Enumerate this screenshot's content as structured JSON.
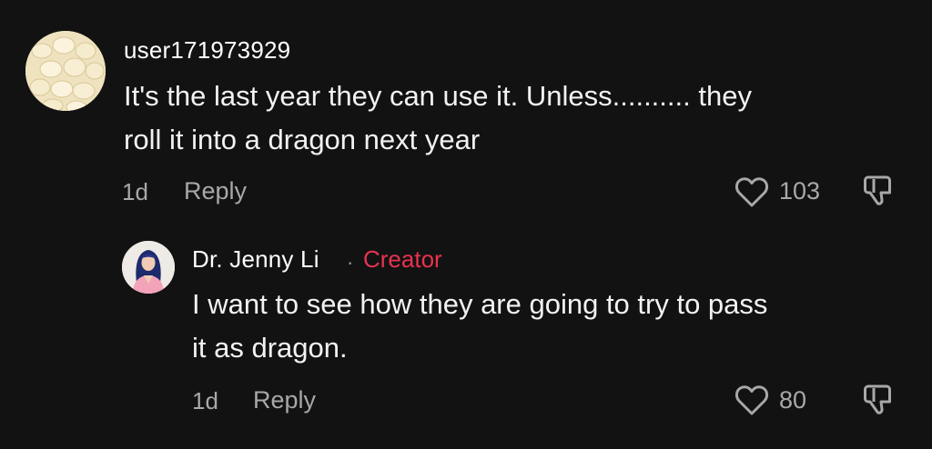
{
  "comments": [
    {
      "username": "user171973929",
      "text_line1": "It's the last year they can use it. Unless.......... they",
      "text_line2": "roll it into a dragon next year",
      "time": "1d",
      "reply_label": "Reply",
      "like_count": "103",
      "avatar_icon": "garlic-avatar",
      "like_icon": "heart-outline-icon",
      "dislike_icon": "thumbs-down-icon"
    },
    {
      "username": "Dr. Jenny Li",
      "separator": "·",
      "badge": "Creator",
      "text_line1": "I want to see how they are going to try to pass",
      "text_line2": "it as dragon.",
      "time": "1d",
      "reply_label": "Reply",
      "like_count": "80",
      "avatar_icon": "person-avatar",
      "like_icon": "heart-outline-icon",
      "dislike_icon": "thumbs-down-icon"
    }
  ],
  "colors": {
    "background": "#121212",
    "text": "#f2f2f2",
    "muted": "#a8a8a8",
    "creator_badge": "#e8324f"
  }
}
